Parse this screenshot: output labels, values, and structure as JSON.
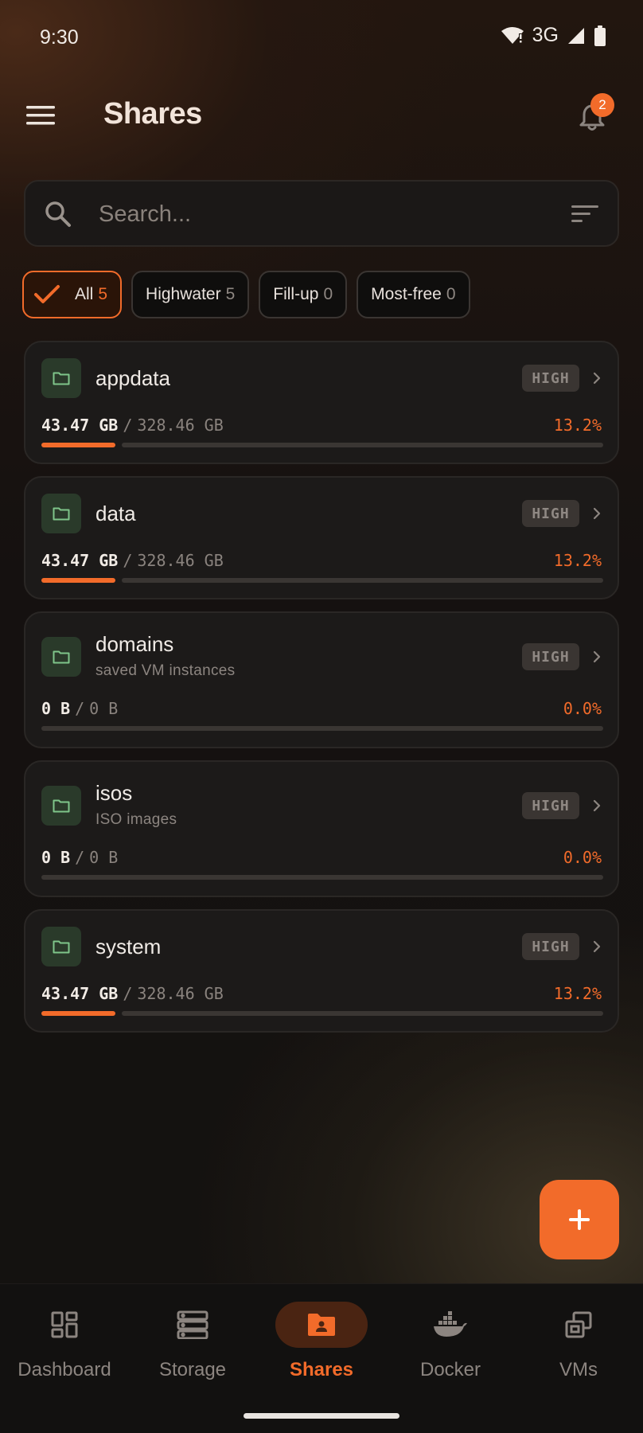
{
  "status_bar": {
    "time": "9:30",
    "network": "3G"
  },
  "app_bar": {
    "title": "Shares",
    "notification_count": "2"
  },
  "search": {
    "placeholder": "Search..."
  },
  "filters": [
    {
      "label": "All",
      "count": "5",
      "active": true
    },
    {
      "label": "Highwater",
      "count": "5",
      "active": false
    },
    {
      "label": "Fill-up",
      "count": "0",
      "active": false
    },
    {
      "label": "Most-free",
      "count": "0",
      "active": false
    }
  ],
  "shares": [
    {
      "name": "appdata",
      "description": "",
      "allocation": "HIGH",
      "used": "43.47 GB",
      "total": "328.46 GB",
      "percent": "13.2%",
      "fraction": 0.132
    },
    {
      "name": "data",
      "description": "",
      "allocation": "HIGH",
      "used": "43.47 GB",
      "total": "328.46 GB",
      "percent": "13.2%",
      "fraction": 0.132
    },
    {
      "name": "domains",
      "description": "saved VM instances",
      "allocation": "HIGH",
      "used": "0 B",
      "total": "0 B",
      "percent": "0.0%",
      "fraction": 0
    },
    {
      "name": "isos",
      "description": "ISO images",
      "allocation": "HIGH",
      "used": "0 B",
      "total": "0 B",
      "percent": "0.0%",
      "fraction": 0
    },
    {
      "name": "system",
      "description": "",
      "allocation": "HIGH",
      "used": "43.47 GB",
      "total": "328.46 GB",
      "percent": "13.2%",
      "fraction": 0.132
    }
  ],
  "usage_separator": "/",
  "bottom_nav": [
    {
      "label": "Dashboard",
      "icon": "dashboard-icon",
      "active": false
    },
    {
      "label": "Storage",
      "icon": "storage-icon",
      "active": false
    },
    {
      "label": "Shares",
      "icon": "shares-folder-icon",
      "active": true
    },
    {
      "label": "Docker",
      "icon": "docker-icon",
      "active": false
    },
    {
      "label": "VMs",
      "icon": "vms-icon",
      "active": false
    }
  ],
  "colors": {
    "accent": "#f26b2a",
    "card": "#1c1a19",
    "folder_icon": "#7fc58a"
  }
}
